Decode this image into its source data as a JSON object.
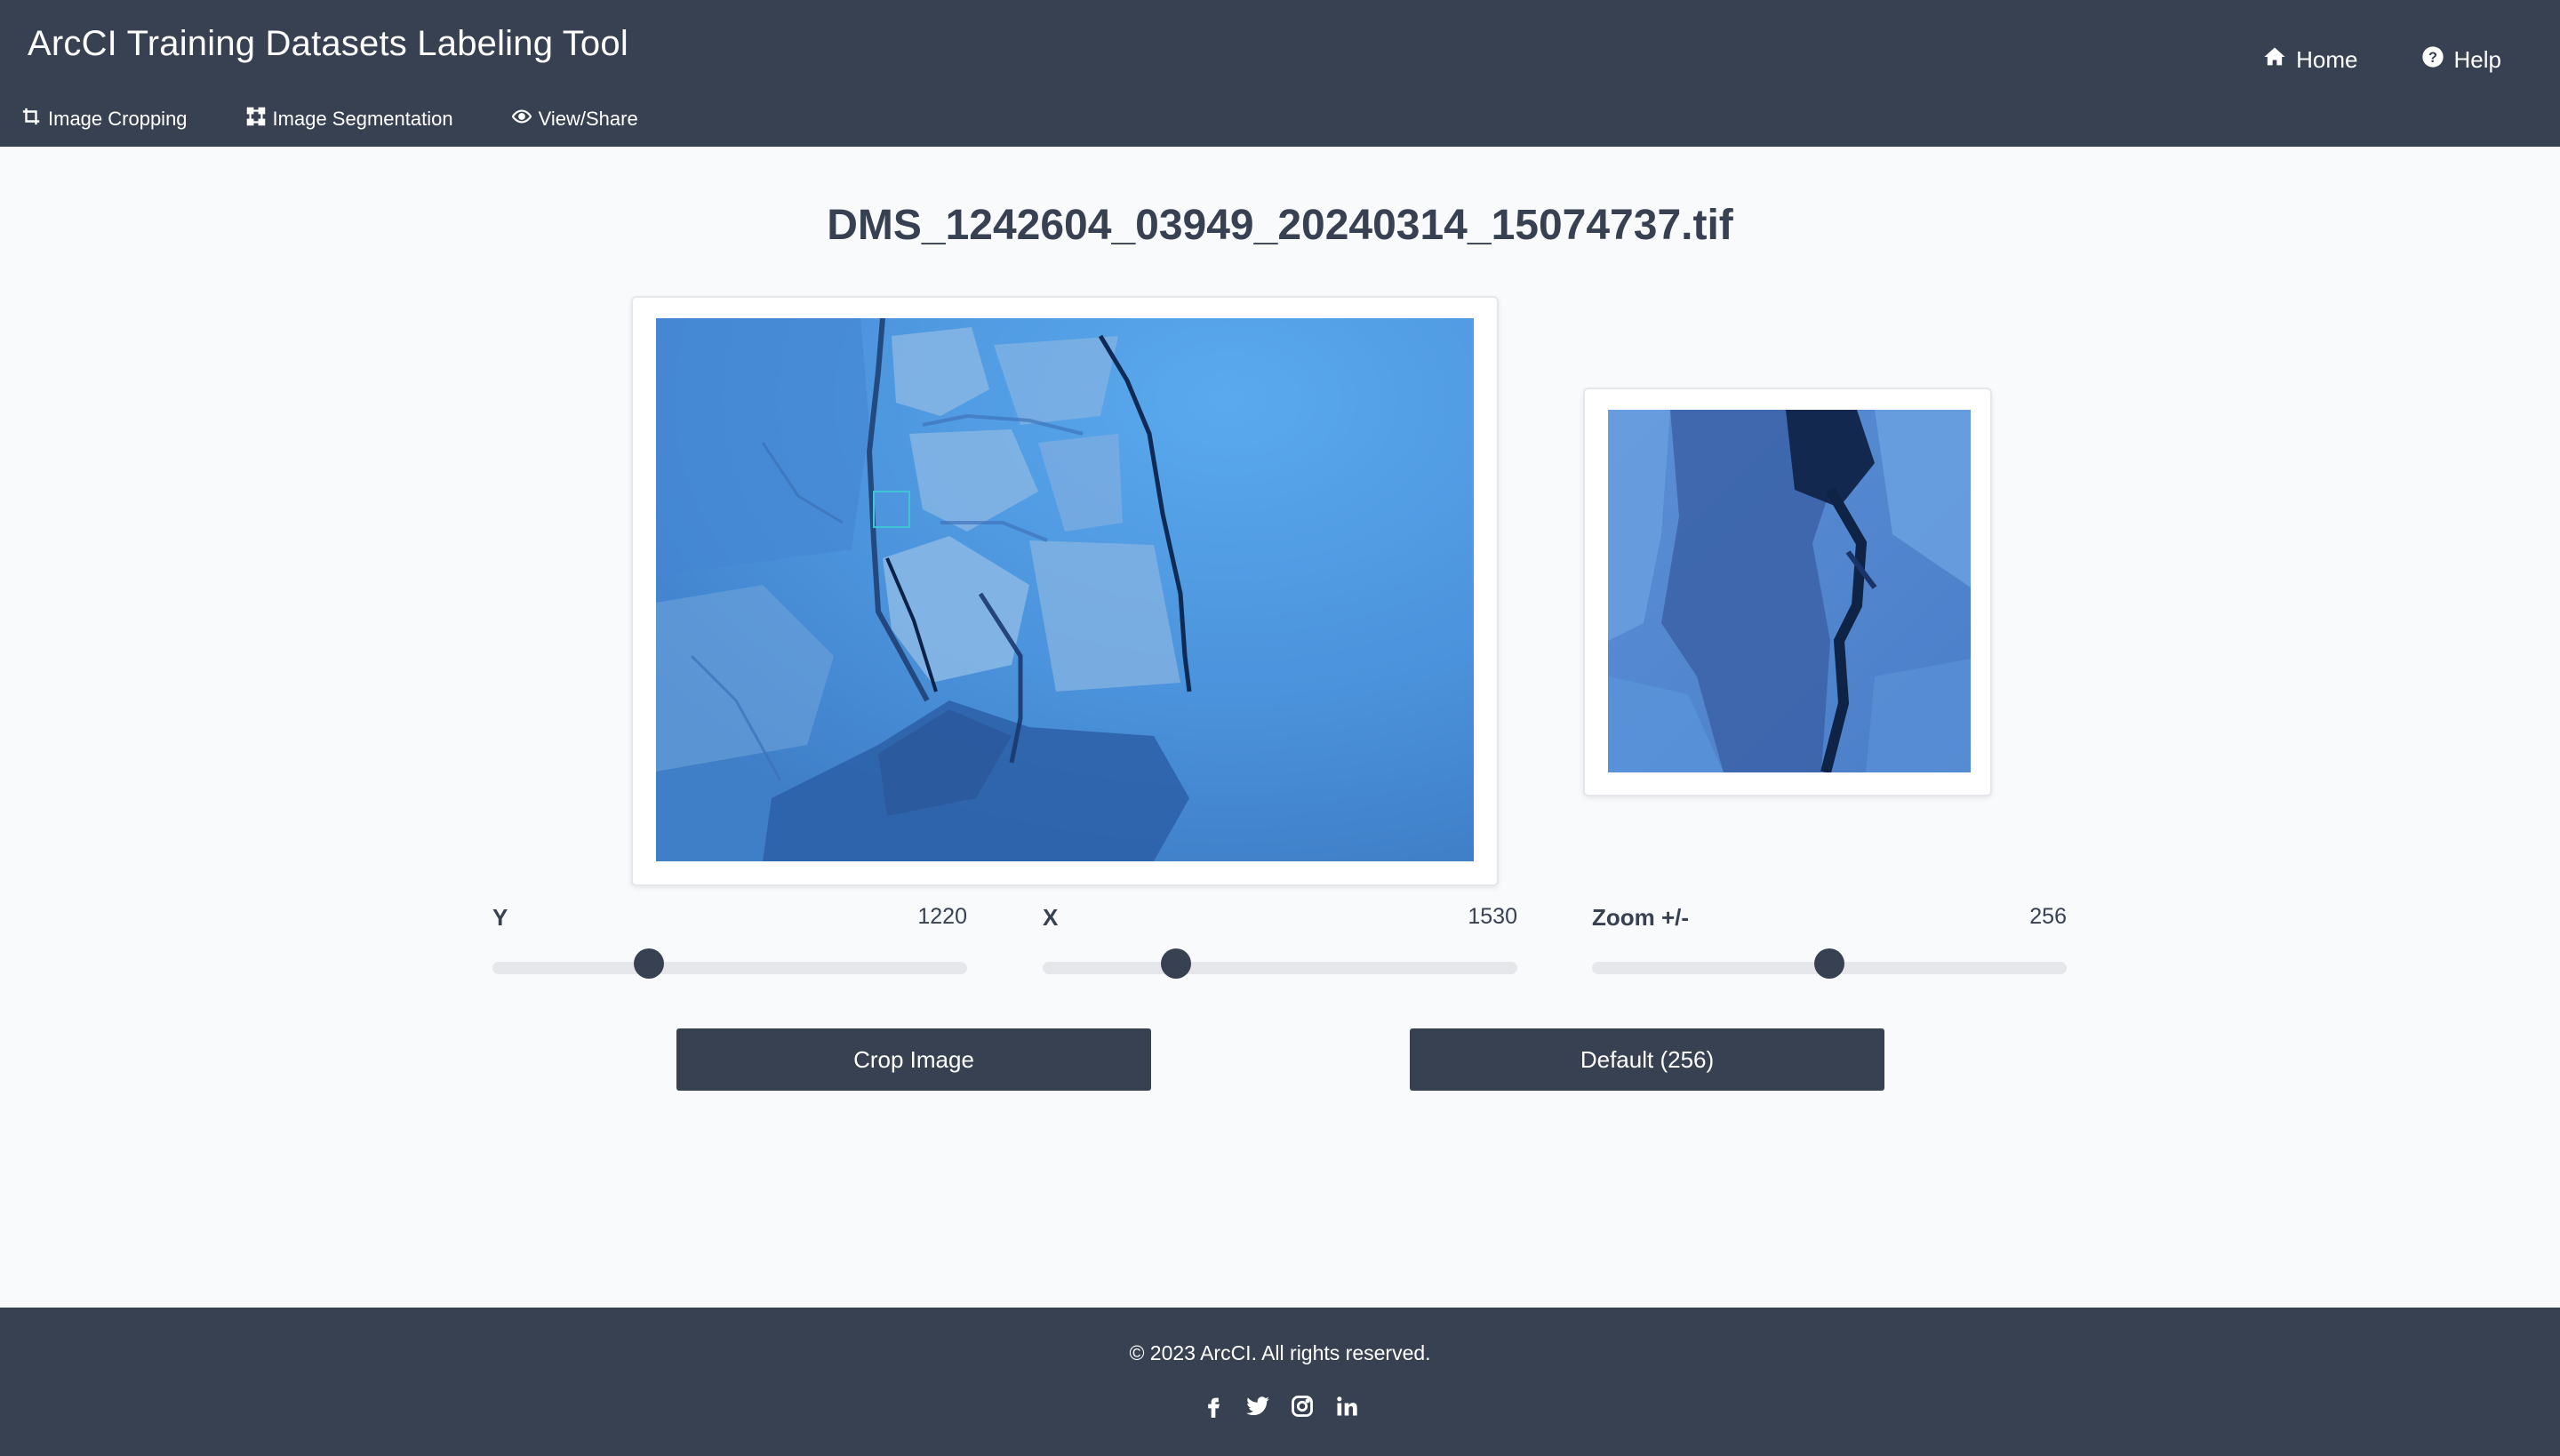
{
  "app": {
    "title": "ArcCI Training Datasets Labeling Tool"
  },
  "top_nav": {
    "home_label": "Home",
    "help_label": "Help"
  },
  "sub_nav": {
    "image_cropping": "Image Cropping",
    "image_segmentation": "Image Segmentation",
    "view_share": "View/Share"
  },
  "page": {
    "file_name": "DMS_1242604_03949_20240314_15074737.tif"
  },
  "sliders": {
    "y": {
      "label": "Y",
      "value": "1220",
      "fraction": 0.33
    },
    "x": {
      "label": "X",
      "value": "1530",
      "fraction": 0.28
    },
    "zoom": {
      "label": "Zoom +/-",
      "value": "256",
      "fraction": 0.5
    }
  },
  "buttons": {
    "crop": "Crop Image",
    "default": "Default (256)"
  },
  "footer": {
    "copyright": "© 2023 ArcCI. All rights reserved."
  },
  "icons": {
    "home": "home-icon",
    "help": "question-circle-icon",
    "crop": "crop-icon",
    "segmentation": "vector-square-icon",
    "view": "eye-icon",
    "facebook": "facebook-icon",
    "twitter": "twitter-icon",
    "instagram": "instagram-icon",
    "linkedin": "linkedin-icon"
  },
  "colors": {
    "header_bg": "#374151",
    "page_bg": "#f8fafc",
    "accent": "#374151",
    "selection_box": "#40c4d4"
  }
}
